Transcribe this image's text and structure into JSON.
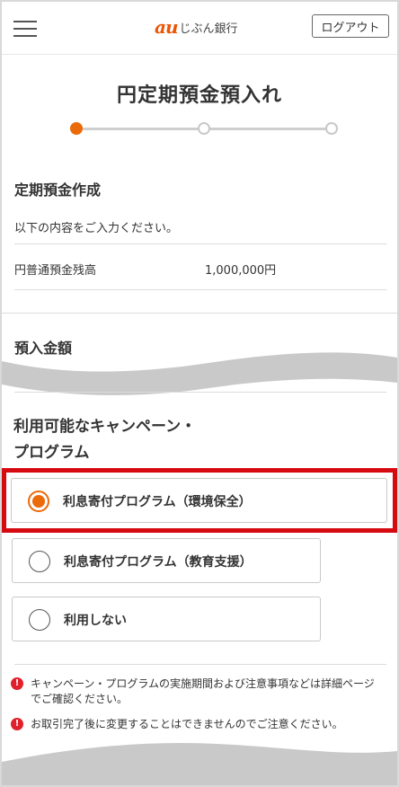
{
  "header": {
    "brand_mark": "au",
    "brand_name": "じぶん銀行",
    "logout_label": "ログアウト"
  },
  "page": {
    "title": "円定期預金預入れ",
    "steps": [
      {
        "state": "active"
      },
      {
        "state": "idle"
      },
      {
        "state": "idle"
      }
    ]
  },
  "form": {
    "section_title": "定期預金作成",
    "intro": "以下の内容をご入力ください。",
    "balance_label": "円普通預金残高",
    "balance_value": "1,000,000円",
    "deposit_label": "預入金額"
  },
  "campaign": {
    "title_line1": "利用可能なキャンペーン・",
    "title_line2": "プログラム",
    "options": [
      {
        "label": "利息寄付プログラム（環境保全）",
        "selected": true
      },
      {
        "label": "利息寄付プログラム（教育支援）",
        "selected": false
      },
      {
        "label": "利用しない",
        "selected": false
      }
    ]
  },
  "notes": [
    "キャンペーン・プログラムの実施期間および注意事項などは詳細ページでご確認ください。",
    "お取引完了後に変更することはできませんのでご注意ください。"
  ],
  "icons": {
    "warning": "exclamation-circle-icon",
    "warning_glyph": "!"
  },
  "colors": {
    "accent": "#eb6a0a",
    "brand": "#eb5505",
    "highlight": "#d60b12",
    "warning": "#e0202a"
  }
}
